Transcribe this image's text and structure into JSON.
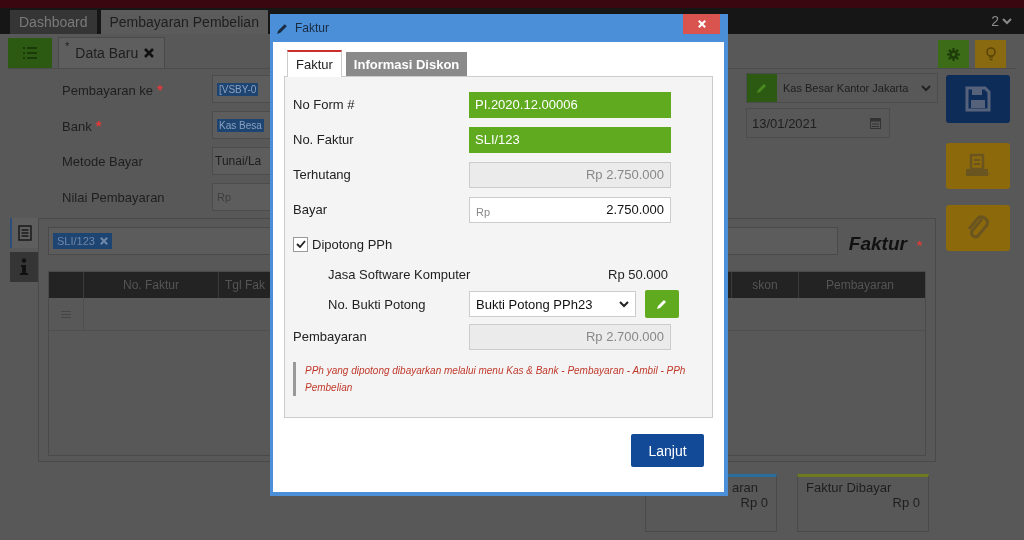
{
  "top_tabs": [
    {
      "label": "Dashboard",
      "selected": false
    },
    {
      "label": "Pembayaran Pembelian",
      "selected": true
    }
  ],
  "top_right_count": "2",
  "doc_tab": {
    "marker": "*",
    "label": "Data Baru"
  },
  "form_fields": [
    {
      "label": "Pembayaran ke",
      "required_mark": "*",
      "kind": "tag",
      "value": "[VSBY-0"
    },
    {
      "label": "Bank",
      "required_mark": "*",
      "kind": "tag",
      "value": "Kas Besa"
    },
    {
      "label": "Metode Bayar",
      "kind": "text",
      "value": "Tunai/La"
    },
    {
      "label": "Nilai Pembayaran",
      "kind": "prefix",
      "prefix": "Rp"
    }
  ],
  "account_select": {
    "value": "Kas Besar Kantor Jakarta"
  },
  "date_field": {
    "value": "13/01/2021"
  },
  "side_tabs": [
    {
      "kind": "list",
      "selected": true
    },
    {
      "kind": "info",
      "selected": false
    }
  ],
  "invoice_tags": [
    "SLI/123"
  ],
  "panel_title": {
    "label": "Faktur",
    "required_mark": "*"
  },
  "table": {
    "columns": [
      "No. Faktur",
      "Tgl Fak",
      "skon",
      "Pembayaran"
    ]
  },
  "summary_cards": [
    {
      "title": "aran",
      "value": "Rp 0",
      "color": "#2a6d9c"
    },
    {
      "title": "Faktur Dibayar",
      "value": "Rp 0",
      "color": "#6f7a20"
    }
  ],
  "modal": {
    "title": "Faktur",
    "tabs": [
      {
        "label": "Faktur",
        "selected": true
      },
      {
        "label": "Informasi Diskon",
        "selected": false
      }
    ],
    "rows": [
      {
        "kind": "highlight",
        "label": "No Form #",
        "value": "PI.2020.12.00006"
      },
      {
        "kind": "highlight",
        "label": "No. Faktur",
        "value": "SLI/123"
      },
      {
        "kind": "readonly",
        "label": "Terhutang",
        "value": "Rp 2.750.000"
      },
      {
        "kind": "input",
        "label": "Bayar",
        "prefix": "Rp",
        "value": "2.750.000"
      }
    ],
    "withholding": {
      "label": "Dipotong PPh",
      "checked": true,
      "service": "Jasa Software Komputer",
      "amount": "Rp 50.000",
      "proof_label": "No. Bukti Potong",
      "proof_value": "Bukti Potong PPh23"
    },
    "payment": {
      "label": "Pembayaran",
      "value": "Rp 2.700.000"
    },
    "note": "PPh yang dipotong dibayarkan melalui menu Kas & Bank - Pembayaran - Ambil - PPh Pembelian",
    "button": "Lanjut"
  }
}
